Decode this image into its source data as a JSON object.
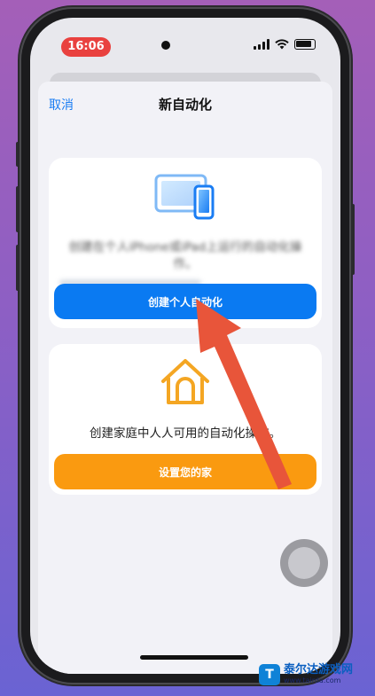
{
  "status_bar": {
    "time": "16:06"
  },
  "nav": {
    "cancel_label": "取消",
    "title": "新自动化"
  },
  "personal_card": {
    "description": "创建在个人iPhone或iPad上运行的自动化操作。",
    "button_label": "创建个人自动化",
    "icon": "iphone-ipad-icon"
  },
  "home_card": {
    "description": "创建家庭中人人可用的自动化操作。",
    "button_label": "设置您的家",
    "icon": "home-icon"
  },
  "overlay": {
    "annotation": "red-arrow-pointing-to-create-button"
  },
  "watermark": {
    "name": "泰尔达游戏网",
    "url": "www.tairda.com",
    "logo": "T"
  },
  "colors": {
    "accent_blue": "#0a7af2",
    "accent_orange": "#fa9a10",
    "time_pill": "#e9413f",
    "arrow": "#e8553a"
  }
}
